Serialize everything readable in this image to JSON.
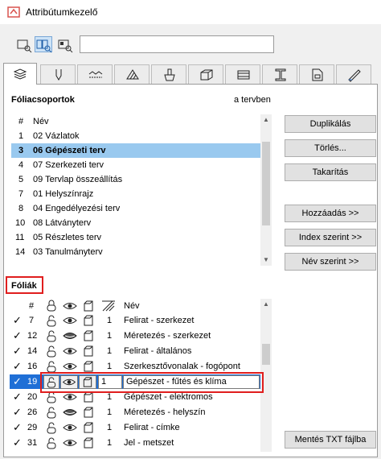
{
  "window": {
    "title": "Attribútumkezelő"
  },
  "toolbar": {
    "view_buttons": [
      "list-view-icon",
      "tile-view-icon",
      "preview-view-icon"
    ],
    "search": {
      "value": "",
      "placeholder": ""
    }
  },
  "tabs": [
    "layers-icon",
    "pen-icon",
    "line-type-icon",
    "fill-icon",
    "surface-icon",
    "building-material-icon",
    "composite-icon",
    "profile-icon",
    "zone-icon",
    "finish-icon"
  ],
  "layer_combinations": {
    "title": "Fóliacsoportok",
    "in_project_label": "a tervben",
    "header": {
      "num": "#",
      "name": "Név"
    },
    "rows": [
      {
        "num": "1",
        "name": "02 Vázlatok"
      },
      {
        "num": "3",
        "name": "06 Gépészeti terv",
        "selected": true
      },
      {
        "num": "4",
        "name": "07 Szerkezeti terv"
      },
      {
        "num": "5",
        "name": "09 Tervlap összeállítás"
      },
      {
        "num": "7",
        "name": "01 Helyszínrajz"
      },
      {
        "num": "8",
        "name": "04 Engedélyezési terv"
      },
      {
        "num": "10",
        "name": "08 Látványterv"
      },
      {
        "num": "11",
        "name": "05 Részletes terv"
      },
      {
        "num": "14",
        "name": "03 Tanulmányterv"
      }
    ]
  },
  "buttons": {
    "duplicate": "Duplikálás",
    "delete": "Törlés...",
    "purge": "Takarítás",
    "add": "Hozzáadás >>",
    "by_index": "Index szerint >>",
    "by_name": "Név szerint >>",
    "save_txt": "Mentés TXT fájlba"
  },
  "layers": {
    "title": "Fóliák",
    "header": {
      "num": "#",
      "name": "Név"
    },
    "rows": [
      {
        "num": "7",
        "intersect": "1",
        "name": "Felirat - szerkezet",
        "visible": true
      },
      {
        "num": "12",
        "intersect": "1",
        "name": "Méretezés - szerkezet",
        "visible": false
      },
      {
        "num": "14",
        "intersect": "1",
        "name": "Felirat - általános",
        "visible": true
      },
      {
        "num": "16",
        "intersect": "1",
        "name": "Szerkesztővonalak - fogópont",
        "visible": true
      },
      {
        "num": "19",
        "intersect": "1",
        "name": "Gépészet - fűtés és klíma",
        "visible": true,
        "editing": true
      },
      {
        "num": "20",
        "intersect": "1",
        "name": "Gépészet - elektromos",
        "visible": true
      },
      {
        "num": "26",
        "intersect": "1",
        "name": "Méretezés - helyszín",
        "visible": false
      },
      {
        "num": "29",
        "intersect": "1",
        "name": "Felirat - címke",
        "visible": true
      },
      {
        "num": "31",
        "intersect": "1",
        "name": "Jel - metszet",
        "visible": true
      }
    ]
  },
  "colors": {
    "selection": "#99c9ef",
    "highlight_border": "#e01e1e",
    "tab_active": "#ffffff"
  }
}
